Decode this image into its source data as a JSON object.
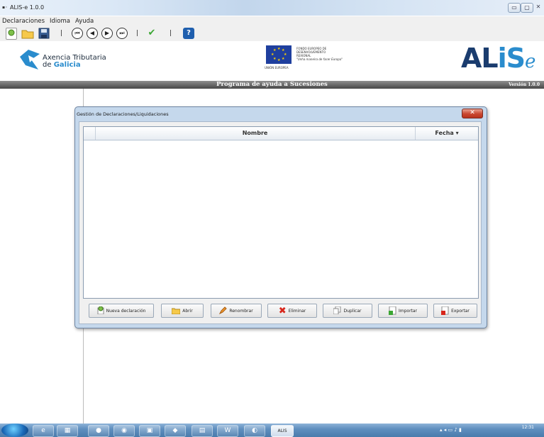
{
  "window": {
    "title": "ALIS-e 1.0.0",
    "controls": {
      "minimize": "▭",
      "maximize": "▢",
      "close": "✕"
    }
  },
  "menu": [
    "Declaraciones",
    "Idioma",
    "Ayuda"
  ],
  "toolbar": {
    "icons": [
      "new-document-icon",
      "open-folder-icon",
      "save-icon",
      "first-icon",
      "previous-icon",
      "next-icon",
      "last-icon",
      "validate-check-icon",
      "help-icon"
    ],
    "help_glyph": "?",
    "nav_glyphs": [
      "⏮",
      "◀",
      "▶",
      "⏭"
    ],
    "check_glyph": "✔"
  },
  "header": {
    "org_line1": "Axencia Tributaria",
    "org_line2_prefix": "de ",
    "org_line2_bold": "Galicia",
    "eu_text_lines": [
      "FONDO EUROPEO DE",
      "DESENVOLVEMENTO",
      "REXIONAL",
      "\"Unha maneira de facer Europa\""
    ],
    "eu_label": "UNIÓN EUROPEA",
    "logo_main": "AL",
    "logo_i": "i",
    "logo_s": "S",
    "logo_e": "e"
  },
  "band": {
    "title": "Programa de ayuda a Sucesiones",
    "version": "Versión 1.0.0"
  },
  "dialog": {
    "title": "Gestión de Declaraciones/Liquidaciones",
    "close_glyph": "✕",
    "columns": {
      "name": "Nombre",
      "date": "Fecha ▾"
    },
    "rows": [],
    "buttons": [
      {
        "label": "Nueva declaración",
        "icon": "new-icon"
      },
      {
        "label": "Abrir",
        "icon": "folder-icon"
      },
      {
        "label": "Renombrar",
        "icon": "pencil-icon"
      },
      {
        "label": "Eliminar",
        "icon": "delete-x-icon"
      },
      {
        "label": "Duplicar",
        "icon": "duplicate-icon"
      },
      {
        "label": "Importar",
        "icon": "import-icon"
      },
      {
        "label": "Exportar",
        "icon": "export-icon"
      }
    ]
  },
  "taskbar": {
    "apps": [
      "ie-icon",
      "explorer-icon",
      "chrome-icon",
      "app-icon",
      "paint-icon",
      "app-icon",
      "calculator-icon",
      "word-icon",
      "app-icon",
      "alis-icon"
    ],
    "active_label": "ALIS",
    "clock": "12:31"
  },
  "colors": {
    "accent_blue": "#2a8ccd",
    "logo_dark": "#1a3c6e",
    "band": "#474747"
  }
}
